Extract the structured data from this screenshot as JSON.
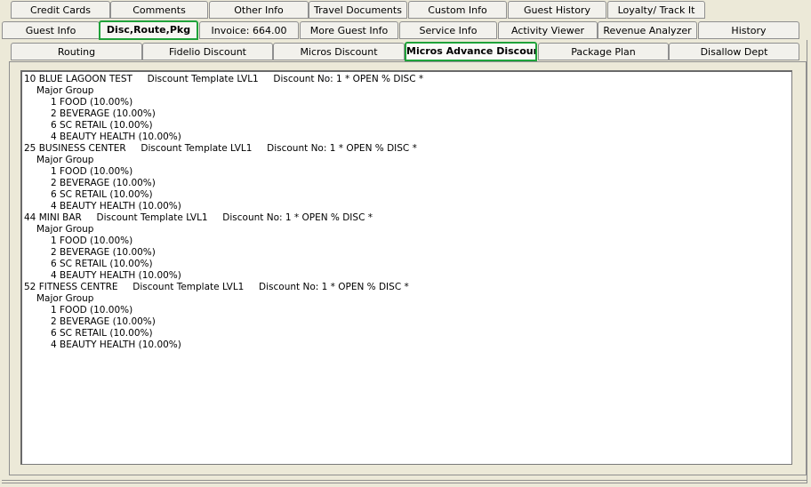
{
  "tabs_row1": [
    "Credit Cards",
    "Comments",
    "Other Info",
    "Travel Documents",
    "Custom Info",
    "Guest History",
    "Loyalty/ Track It"
  ],
  "tabs_row2": [
    "Guest Info",
    "Disc,Route,Pkg",
    "Invoice: 664.00",
    "More Guest Info",
    "Service Info",
    "Activity Viewer",
    "Revenue Analyzer",
    "History"
  ],
  "tabs_row3": [
    "Routing",
    "Fidelio Discount",
    "Micros Discount",
    "Micros Advance Discount",
    "Package Plan",
    "Disallow Dept"
  ],
  "active_tab_row2": "Disc,Route,Pkg",
  "active_tab_row3": "Micros Advance Discount",
  "accent_color": "#1fa23a",
  "discount_lines": [
    {
      "level": 0,
      "text": "10 BLUE LAGOON TEST     Discount Template LVL1     Discount No: 1 * OPEN % DISC *"
    },
    {
      "level": 1,
      "text": "Major Group"
    },
    {
      "level": 2,
      "text": "1 FOOD (10.00%)"
    },
    {
      "level": 2,
      "text": "2 BEVERAGE (10.00%)"
    },
    {
      "level": 2,
      "text": "6 SC RETAIL (10.00%)"
    },
    {
      "level": 2,
      "text": "4 BEAUTY HEALTH (10.00%)"
    },
    {
      "level": 0,
      "text": "25 BUSINESS CENTER     Discount Template LVL1     Discount No: 1 * OPEN % DISC *"
    },
    {
      "level": 1,
      "text": "Major Group"
    },
    {
      "level": 2,
      "text": "1 FOOD (10.00%)"
    },
    {
      "level": 2,
      "text": "2 BEVERAGE (10.00%)"
    },
    {
      "level": 2,
      "text": "6 SC RETAIL (10.00%)"
    },
    {
      "level": 2,
      "text": "4 BEAUTY HEALTH (10.00%)"
    },
    {
      "level": 0,
      "text": "44 MINI BAR     Discount Template LVL1     Discount No: 1 * OPEN % DISC *"
    },
    {
      "level": 1,
      "text": "Major Group"
    },
    {
      "level": 2,
      "text": "1 FOOD (10.00%)"
    },
    {
      "level": 2,
      "text": "2 BEVERAGE (10.00%)"
    },
    {
      "level": 2,
      "text": "6 SC RETAIL (10.00%)"
    },
    {
      "level": 2,
      "text": "4 BEAUTY HEALTH (10.00%)"
    },
    {
      "level": 0,
      "text": "52 FITNESS CENTRE     Discount Template LVL1     Discount No: 1 * OPEN % DISC *"
    },
    {
      "level": 1,
      "text": "Major Group"
    },
    {
      "level": 2,
      "text": "1 FOOD (10.00%)"
    },
    {
      "level": 2,
      "text": "2 BEVERAGE (10.00%)"
    },
    {
      "level": 2,
      "text": "6 SC RETAIL (10.00%)"
    },
    {
      "level": 2,
      "text": "4 BEAUTY HEALTH (10.00%)"
    }
  ]
}
